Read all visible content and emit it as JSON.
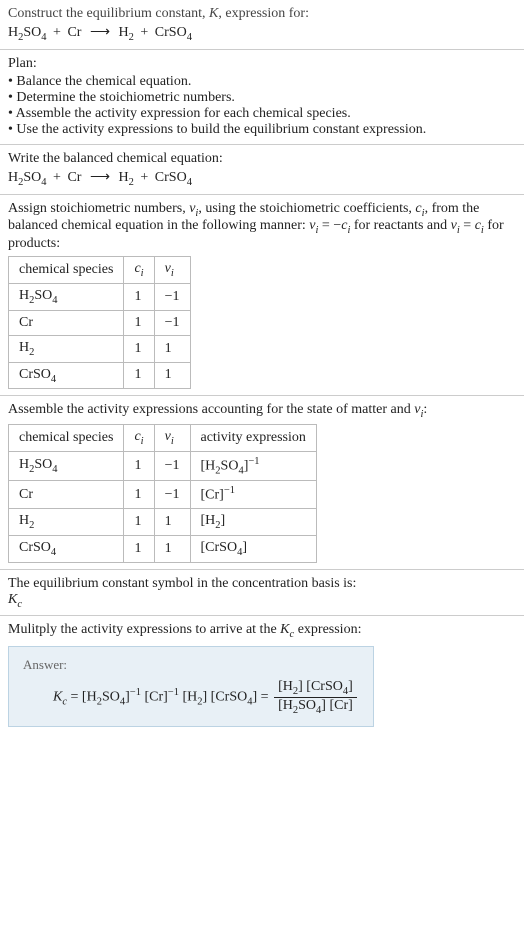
{
  "s1": {
    "line1": "Construct the equilibrium constant, ",
    "kital": "K",
    "line1b": ", expression for:"
  },
  "eq": {
    "h2so4_a": "H",
    "h2so4_b": "2",
    "h2so4_c": "SO",
    "h2so4_d": "4",
    "plus": "+",
    "cr": "Cr",
    "arrow": "⟶",
    "h2_a": "H",
    "h2_b": "2",
    "crso4_a": "CrSO",
    "crso4_b": "4"
  },
  "plan": {
    "title": "Plan:",
    "items": [
      "Balance the chemical equation.",
      "Determine the stoichiometric numbers.",
      "Assemble the activity expression for each chemical species.",
      "Use the activity expressions to build the equilibrium constant expression."
    ]
  },
  "balanced_title": "Write the balanced chemical equation:",
  "stoich": {
    "line1a": "Assign stoichiometric numbers, ",
    "nu": "ν",
    "isub": "i",
    "line1b": ", using the stoichiometric coefficients, ",
    "c": "c",
    "line1c": ", from the balanced chemical equation in the following manner: ",
    "rel1a": "ν",
    "rel1b": "i",
    "rel1c": " = −",
    "rel1d": "c",
    "rel1e": "i",
    "line1d": " for reactants and ",
    "rel2a": "ν",
    "rel2b": "i",
    "rel2c": " = ",
    "rel2d": "c",
    "rel2e": "i",
    "line1e": " for products:",
    "headers": {
      "species": "chemical species"
    },
    "rows": [
      {
        "ci": "1",
        "vi": "−1"
      },
      {
        "ci": "1",
        "vi": "−1"
      },
      {
        "ci": "1",
        "vi": "1"
      },
      {
        "ci": "1",
        "vi": "1"
      }
    ]
  },
  "activity": {
    "title_a": "Assemble the activity expressions accounting for the state of matter and ",
    "title_b": ":",
    "header_act": "activity expression",
    "rows": [
      {
        "ci": "1",
        "vi": "−1"
      },
      {
        "ci": "1",
        "vi": "−1"
      },
      {
        "ci": "1",
        "vi": "1"
      },
      {
        "ci": "1",
        "vi": "1"
      }
    ],
    "exp_neg1": "−1",
    "cr_expr": "[Cr]"
  },
  "basis": {
    "line": "The equilibrium constant symbol in the concentration basis is:",
    "k": "K",
    "csub": "c"
  },
  "mult": {
    "line_a": "Mulitply the activity expressions to arrive at the ",
    "k": "K",
    "csub": "c",
    "line_b": " expression:"
  },
  "answer": {
    "label": "Answer:",
    "k": "K",
    "csub": "c",
    "equals": " = ",
    "cr_inv": "[Cr]",
    "neg1": "−1",
    "mid_eq": " = ",
    "den_cr": "[Cr]"
  },
  "chart_data": {
    "type": "table",
    "tables": [
      {
        "title": "stoichiometric numbers",
        "columns": [
          "chemical species",
          "c_i",
          "ν_i"
        ],
        "rows": [
          [
            "H2SO4",
            1,
            -1
          ],
          [
            "Cr",
            1,
            -1
          ],
          [
            "H2",
            1,
            1
          ],
          [
            "CrSO4",
            1,
            1
          ]
        ]
      },
      {
        "title": "activity expressions",
        "columns": [
          "chemical species",
          "c_i",
          "ν_i",
          "activity expression"
        ],
        "rows": [
          [
            "H2SO4",
            1,
            -1,
            "[H2SO4]^-1"
          ],
          [
            "Cr",
            1,
            -1,
            "[Cr]^-1"
          ],
          [
            "H2",
            1,
            1,
            "[H2]"
          ],
          [
            "CrSO4",
            1,
            1,
            "[CrSO4]"
          ]
        ]
      }
    ],
    "equilibrium_expression": "K_c = [H2SO4]^-1 [Cr]^-1 [H2] [CrSO4] = ([H2][CrSO4]) / ([H2SO4][Cr])"
  }
}
